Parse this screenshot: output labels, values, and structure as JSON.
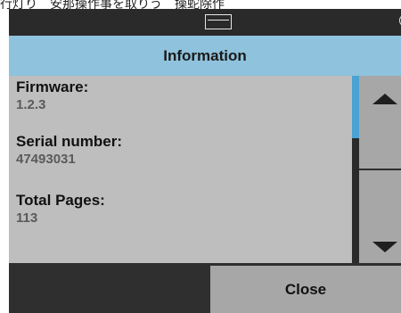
{
  "top_strip_text": "行灯り　安那操作事を取りう　操蛇除作",
  "status_bar": {
    "icons": [
      "printer-icon",
      "power-icon"
    ]
  },
  "header": {
    "title": "Information"
  },
  "fields": [
    {
      "label": "Firmware:",
      "value": "1.2.3"
    },
    {
      "label": "Serial number:",
      "value": "47493031"
    },
    {
      "label": "Total Pages:",
      "value": "113"
    }
  ],
  "scroll": {
    "position_fraction": 0.0,
    "up_icon": "triangle-up-icon",
    "down_icon": "triangle-down-icon"
  },
  "footer": {
    "close_label": "Close"
  },
  "colors": {
    "header": "#8fc2dc",
    "content": "#bebebe",
    "button": "#a7a7a7",
    "dark": "#2f2f2f",
    "scroll_thumb": "#4aa3d3"
  }
}
